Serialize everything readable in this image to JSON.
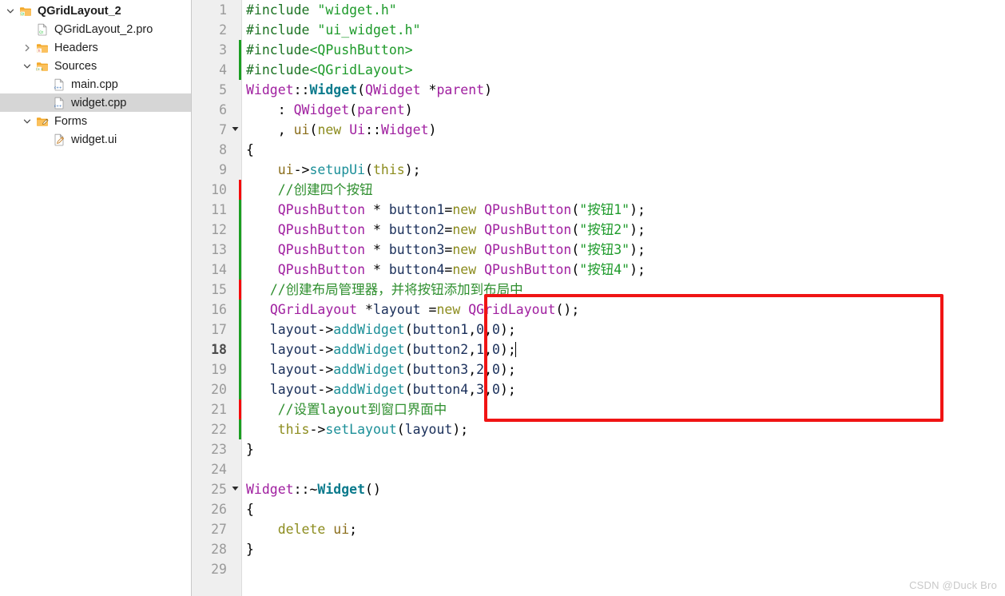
{
  "sidebar": {
    "items": [
      {
        "label": "QGridLayout_2",
        "indent": 0,
        "twisty": "chevron-down-icon",
        "icon": "qt-folder-icon",
        "bold": true,
        "selected": false,
        "name": "tree-item-qgridlayout-2"
      },
      {
        "label": "QGridLayout_2.pro",
        "indent": 1,
        "twisty": "none",
        "icon": "qt-pro-file-icon",
        "bold": false,
        "selected": false,
        "name": "tree-item-qgridlayout-2-pro"
      },
      {
        "label": "Headers",
        "indent": 1,
        "twisty": "chevron-right-icon",
        "icon": "headers-folder-icon",
        "bold": false,
        "selected": false,
        "name": "tree-item-headers"
      },
      {
        "label": "Sources",
        "indent": 1,
        "twisty": "chevron-down-icon",
        "icon": "sources-folder-icon",
        "bold": false,
        "selected": false,
        "name": "tree-item-sources"
      },
      {
        "label": "main.cpp",
        "indent": 2,
        "twisty": "none",
        "icon": "cpp-file-icon",
        "bold": false,
        "selected": false,
        "name": "tree-item-main-cpp"
      },
      {
        "label": "widget.cpp",
        "indent": 2,
        "twisty": "none",
        "icon": "cpp-file-icon",
        "bold": false,
        "selected": true,
        "name": "tree-item-widget-cpp"
      },
      {
        "label": "Forms",
        "indent": 1,
        "twisty": "chevron-down-icon",
        "icon": "forms-folder-icon",
        "bold": false,
        "selected": false,
        "name": "tree-item-forms"
      },
      {
        "label": "widget.ui",
        "indent": 2,
        "twisty": "none",
        "icon": "ui-file-icon",
        "bold": false,
        "selected": false,
        "name": "tree-item-widget-ui"
      }
    ]
  },
  "editor": {
    "current_line": 18,
    "lines": [
      {
        "n": 1,
        "fold": "none",
        "change": "none",
        "tokens": [
          {
            "t": "pre",
            "v": "#include "
          },
          {
            "t": "str",
            "v": "\"widget.h\""
          }
        ]
      },
      {
        "n": 2,
        "fold": "none",
        "change": "none",
        "tokens": [
          {
            "t": "pre",
            "v": "#include "
          },
          {
            "t": "str",
            "v": "\"ui_widget.h\""
          }
        ]
      },
      {
        "n": 3,
        "fold": "none",
        "change": "green",
        "tokens": [
          {
            "t": "pre",
            "v": "#include"
          },
          {
            "t": "str",
            "v": "<QPushButton>"
          }
        ]
      },
      {
        "n": 4,
        "fold": "none",
        "change": "green",
        "tokens": [
          {
            "t": "pre",
            "v": "#include"
          },
          {
            "t": "str",
            "v": "<QGridLayout>"
          }
        ]
      },
      {
        "n": 5,
        "fold": "none",
        "change": "none",
        "tokens": [
          {
            "t": "type",
            "v": "Widget"
          },
          {
            "t": "op",
            "v": "::"
          },
          {
            "t": "funcdef",
            "v": "Widget"
          },
          {
            "t": "op",
            "v": "("
          },
          {
            "t": "type",
            "v": "QWidget "
          },
          {
            "t": "op",
            "v": "*"
          },
          {
            "t": "type",
            "v": "parent"
          },
          {
            "t": "op",
            "v": ")"
          }
        ]
      },
      {
        "n": 6,
        "fold": "none",
        "change": "none",
        "tokens": [
          {
            "t": "plain",
            "v": "    "
          },
          {
            "t": "op",
            "v": ": "
          },
          {
            "t": "type",
            "v": "QWidget"
          },
          {
            "t": "op",
            "v": "("
          },
          {
            "t": "type",
            "v": "parent"
          },
          {
            "t": "op",
            "v": ")"
          }
        ]
      },
      {
        "n": 7,
        "fold": "down",
        "change": "none",
        "tokens": [
          {
            "t": "plain",
            "v": "    "
          },
          {
            "t": "op",
            "v": ", "
          },
          {
            "t": "field",
            "v": "ui"
          },
          {
            "t": "op",
            "v": "("
          },
          {
            "t": "kw",
            "v": "new "
          },
          {
            "t": "type",
            "v": "Ui"
          },
          {
            "t": "op",
            "v": "::"
          },
          {
            "t": "type",
            "v": "Widget"
          },
          {
            "t": "op",
            "v": ")"
          }
        ]
      },
      {
        "n": 8,
        "fold": "none",
        "change": "none",
        "tokens": [
          {
            "t": "op",
            "v": "{"
          }
        ]
      },
      {
        "n": 9,
        "fold": "none",
        "change": "none",
        "tokens": [
          {
            "t": "plain",
            "v": "    "
          },
          {
            "t": "field",
            "v": "ui"
          },
          {
            "t": "op",
            "v": "->"
          },
          {
            "t": "func",
            "v": "setupUi"
          },
          {
            "t": "op",
            "v": "("
          },
          {
            "t": "kw",
            "v": "this"
          },
          {
            "t": "op",
            "v": ");"
          }
        ]
      },
      {
        "n": 10,
        "fold": "none",
        "change": "red",
        "tokens": [
          {
            "t": "plain",
            "v": "    "
          },
          {
            "t": "comment",
            "v": "//创建四个按钮"
          }
        ]
      },
      {
        "n": 11,
        "fold": "none",
        "change": "green",
        "tokens": [
          {
            "t": "plain",
            "v": "    "
          },
          {
            "t": "type",
            "v": "QPushButton "
          },
          {
            "t": "op",
            "v": "* "
          },
          {
            "t": "ident",
            "v": "button1"
          },
          {
            "t": "op",
            "v": "="
          },
          {
            "t": "kw",
            "v": "new "
          },
          {
            "t": "type",
            "v": "QPushButton"
          },
          {
            "t": "op",
            "v": "("
          },
          {
            "t": "str",
            "v": "\"按钮1\""
          },
          {
            "t": "op",
            "v": ");"
          }
        ]
      },
      {
        "n": 12,
        "fold": "none",
        "change": "green",
        "tokens": [
          {
            "t": "plain",
            "v": "    "
          },
          {
            "t": "type",
            "v": "QPushButton "
          },
          {
            "t": "op",
            "v": "* "
          },
          {
            "t": "ident",
            "v": "button2"
          },
          {
            "t": "op",
            "v": "="
          },
          {
            "t": "kw",
            "v": "new "
          },
          {
            "t": "type",
            "v": "QPushButton"
          },
          {
            "t": "op",
            "v": "("
          },
          {
            "t": "str",
            "v": "\"按钮2\""
          },
          {
            "t": "op",
            "v": ");"
          }
        ]
      },
      {
        "n": 13,
        "fold": "none",
        "change": "green",
        "tokens": [
          {
            "t": "plain",
            "v": "    "
          },
          {
            "t": "type",
            "v": "QPushButton "
          },
          {
            "t": "op",
            "v": "* "
          },
          {
            "t": "ident",
            "v": "button3"
          },
          {
            "t": "op",
            "v": "="
          },
          {
            "t": "kw",
            "v": "new "
          },
          {
            "t": "type",
            "v": "QPushButton"
          },
          {
            "t": "op",
            "v": "("
          },
          {
            "t": "str",
            "v": "\"按钮3\""
          },
          {
            "t": "op",
            "v": ");"
          }
        ]
      },
      {
        "n": 14,
        "fold": "none",
        "change": "green",
        "tokens": [
          {
            "t": "plain",
            "v": "    "
          },
          {
            "t": "type",
            "v": "QPushButton "
          },
          {
            "t": "op",
            "v": "* "
          },
          {
            "t": "ident",
            "v": "button4"
          },
          {
            "t": "op",
            "v": "="
          },
          {
            "t": "kw",
            "v": "new "
          },
          {
            "t": "type",
            "v": "QPushButton"
          },
          {
            "t": "op",
            "v": "("
          },
          {
            "t": "str",
            "v": "\"按钮4\""
          },
          {
            "t": "op",
            "v": ");"
          }
        ]
      },
      {
        "n": 15,
        "fold": "none",
        "change": "red",
        "tokens": [
          {
            "t": "plain",
            "v": "   "
          },
          {
            "t": "comment",
            "v": "//创建布局管理器，并将按钮添加到布局中"
          }
        ]
      },
      {
        "n": 16,
        "fold": "none",
        "change": "green",
        "tokens": [
          {
            "t": "plain",
            "v": "   "
          },
          {
            "t": "type",
            "v": "QGridLayout "
          },
          {
            "t": "op",
            "v": "*"
          },
          {
            "t": "ident",
            "v": "layout "
          },
          {
            "t": "op",
            "v": "="
          },
          {
            "t": "kw",
            "v": "new "
          },
          {
            "t": "type",
            "v": "QGridLayout"
          },
          {
            "t": "op",
            "v": "();"
          }
        ]
      },
      {
        "n": 17,
        "fold": "none",
        "change": "green",
        "tokens": [
          {
            "t": "plain",
            "v": "   "
          },
          {
            "t": "ident",
            "v": "layout"
          },
          {
            "t": "op",
            "v": "->"
          },
          {
            "t": "func",
            "v": "addWidget"
          },
          {
            "t": "op",
            "v": "("
          },
          {
            "t": "ident",
            "v": "button1"
          },
          {
            "t": "op",
            "v": ","
          },
          {
            "t": "num",
            "v": "0"
          },
          {
            "t": "op",
            "v": ","
          },
          {
            "t": "num",
            "v": "0"
          },
          {
            "t": "op",
            "v": ");"
          }
        ]
      },
      {
        "n": 18,
        "fold": "none",
        "change": "green",
        "caret": true,
        "tokens": [
          {
            "t": "plain",
            "v": "   "
          },
          {
            "t": "ident",
            "v": "layout"
          },
          {
            "t": "op",
            "v": "->"
          },
          {
            "t": "func",
            "v": "addWidget"
          },
          {
            "t": "op",
            "v": "("
          },
          {
            "t": "ident",
            "v": "button2"
          },
          {
            "t": "op",
            "v": ","
          },
          {
            "t": "num",
            "v": "1"
          },
          {
            "t": "op",
            "v": ","
          },
          {
            "t": "num",
            "v": "0"
          },
          {
            "t": "op",
            "v": ");"
          }
        ]
      },
      {
        "n": 19,
        "fold": "none",
        "change": "green",
        "tokens": [
          {
            "t": "plain",
            "v": "   "
          },
          {
            "t": "ident",
            "v": "layout"
          },
          {
            "t": "op",
            "v": "->"
          },
          {
            "t": "func",
            "v": "addWidget"
          },
          {
            "t": "op",
            "v": "("
          },
          {
            "t": "ident",
            "v": "button3"
          },
          {
            "t": "op",
            "v": ","
          },
          {
            "t": "num",
            "v": "2"
          },
          {
            "t": "op",
            "v": ","
          },
          {
            "t": "num",
            "v": "0"
          },
          {
            "t": "op",
            "v": ");"
          }
        ]
      },
      {
        "n": 20,
        "fold": "none",
        "change": "green",
        "tokens": [
          {
            "t": "plain",
            "v": "   "
          },
          {
            "t": "ident",
            "v": "layout"
          },
          {
            "t": "op",
            "v": "->"
          },
          {
            "t": "func",
            "v": "addWidget"
          },
          {
            "t": "op",
            "v": "("
          },
          {
            "t": "ident",
            "v": "button4"
          },
          {
            "t": "op",
            "v": ","
          },
          {
            "t": "num",
            "v": "3"
          },
          {
            "t": "op",
            "v": ","
          },
          {
            "t": "num",
            "v": "0"
          },
          {
            "t": "op",
            "v": ");"
          }
        ]
      },
      {
        "n": 21,
        "fold": "none",
        "change": "red",
        "tokens": [
          {
            "t": "plain",
            "v": "    "
          },
          {
            "t": "comment",
            "v": "//设置layout到窗口界面中"
          }
        ]
      },
      {
        "n": 22,
        "fold": "none",
        "change": "green",
        "tokens": [
          {
            "t": "plain",
            "v": "    "
          },
          {
            "t": "kw",
            "v": "this"
          },
          {
            "t": "op",
            "v": "->"
          },
          {
            "t": "func",
            "v": "setLayout"
          },
          {
            "t": "op",
            "v": "("
          },
          {
            "t": "ident",
            "v": "layout"
          },
          {
            "t": "op",
            "v": ");"
          }
        ]
      },
      {
        "n": 23,
        "fold": "none",
        "change": "none",
        "tokens": [
          {
            "t": "op",
            "v": "}"
          }
        ]
      },
      {
        "n": 24,
        "fold": "none",
        "change": "none",
        "tokens": [
          {
            "t": "plain",
            "v": ""
          }
        ]
      },
      {
        "n": 25,
        "fold": "down",
        "change": "none",
        "tokens": [
          {
            "t": "type",
            "v": "Widget"
          },
          {
            "t": "op",
            "v": "::~"
          },
          {
            "t": "funcdef",
            "v": "Widget"
          },
          {
            "t": "op",
            "v": "()"
          }
        ]
      },
      {
        "n": 26,
        "fold": "none",
        "change": "none",
        "tokens": [
          {
            "t": "op",
            "v": "{"
          }
        ]
      },
      {
        "n": 27,
        "fold": "none",
        "change": "none",
        "tokens": [
          {
            "t": "plain",
            "v": "    "
          },
          {
            "t": "kw",
            "v": "delete "
          },
          {
            "t": "field",
            "v": "ui"
          },
          {
            "t": "op",
            "v": ";"
          }
        ]
      },
      {
        "n": 28,
        "fold": "none",
        "change": "none",
        "tokens": [
          {
            "t": "op",
            "v": "}"
          }
        ]
      },
      {
        "n": 29,
        "fold": "none",
        "change": "none",
        "tokens": [
          {
            "t": "plain",
            "v": ""
          }
        ]
      }
    ]
  },
  "annotation": {
    "box_color": "#f01414",
    "covers_lines": "15-20"
  },
  "watermark": {
    "text": "CSDN @Duck Bro"
  },
  "colors": {
    "selection": "#d6d6d6",
    "gutter_bg": "#efefef",
    "change_added": "#1b9e21",
    "change_modified": "#f40b0b",
    "comment": "#2f8f2f",
    "string": "#1d9a2a",
    "type": "#a020a0",
    "keyword": "#8c8c1e",
    "function": "#1b8f98"
  }
}
